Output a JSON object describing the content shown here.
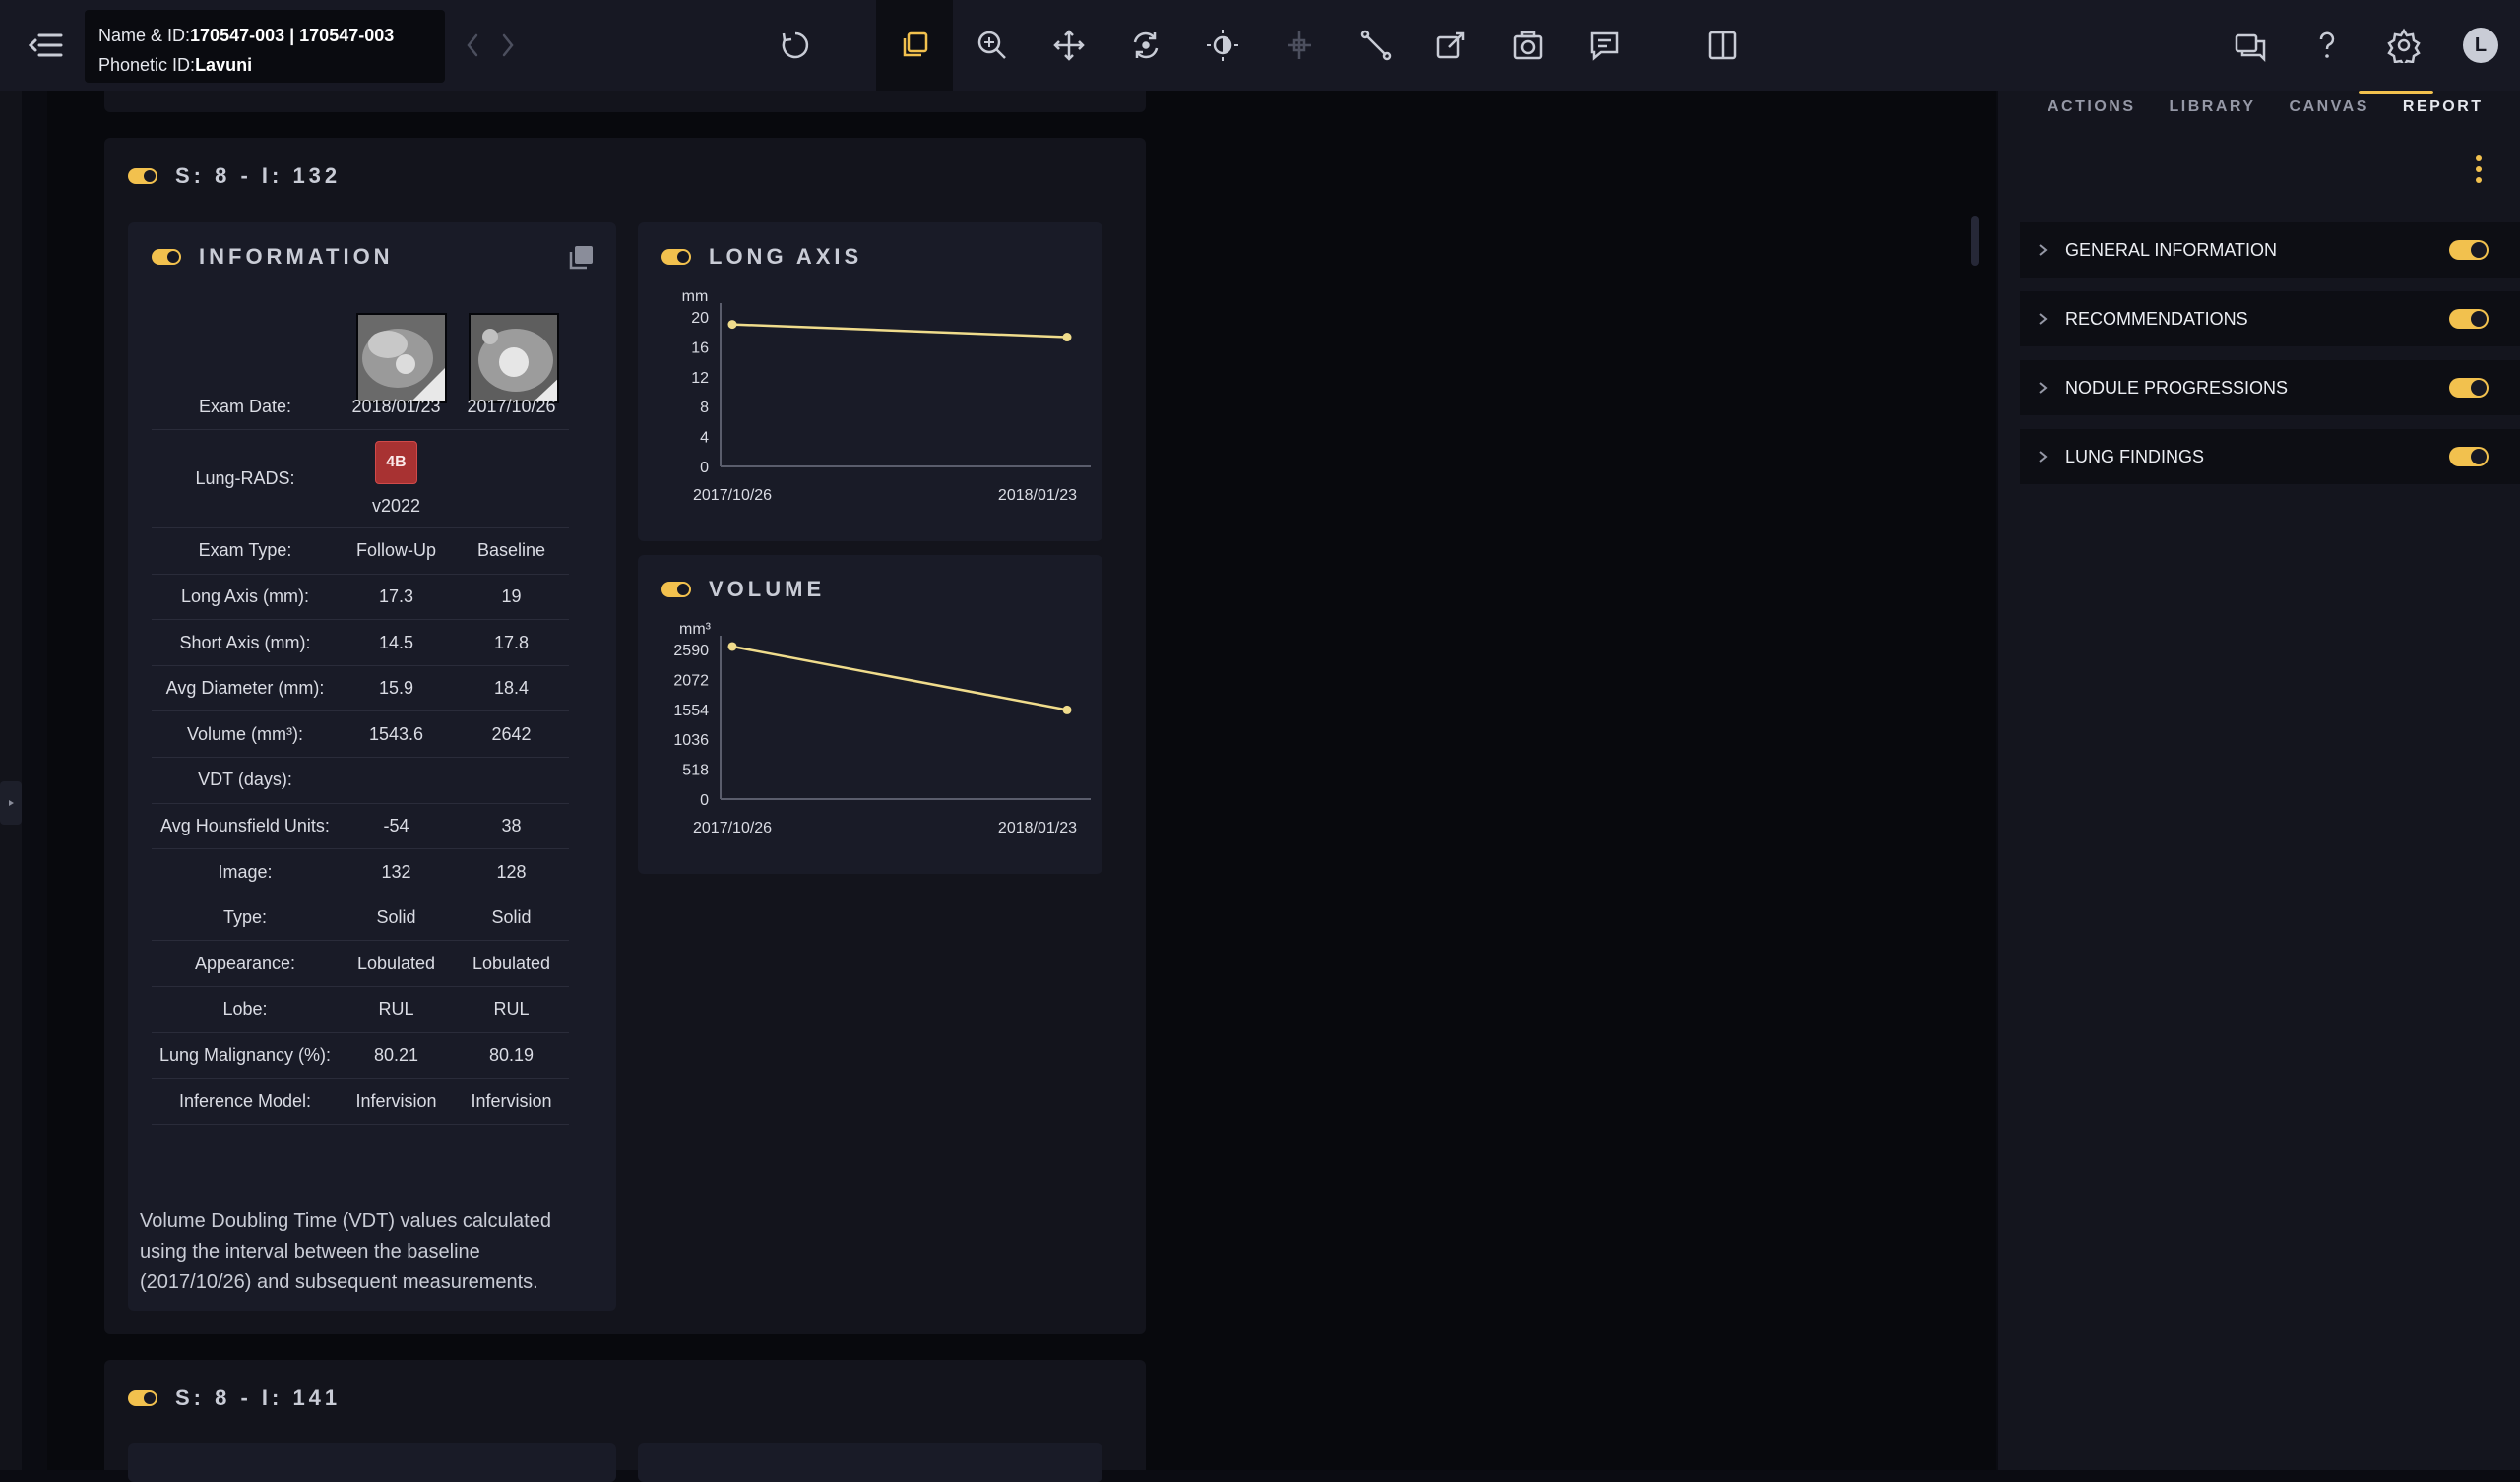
{
  "header": {
    "name_label": "Name & ID:",
    "name_value": "170547-003 | 170547-003",
    "phonetic_label": "Phonetic ID:",
    "phonetic_value": "Lavuni"
  },
  "toolbar": {
    "tools": [
      "reset-icon",
      "stack-icon",
      "zoom-icon",
      "pan-icon",
      "rotate-icon",
      "contrast-icon",
      "crosshair-icon",
      "ruler-icon",
      "annotate-icon",
      "capture-icon",
      "comment-icon",
      "split-view-icon"
    ],
    "right_icons": [
      "chat-icon",
      "help-icon",
      "settings-icon"
    ],
    "avatar_initial": "L",
    "accent": "#f2c14e"
  },
  "sidepanel": {
    "tabs": [
      {
        "label": "ACTIONS"
      },
      {
        "label": "LIBRARY"
      },
      {
        "label": "CANVAS"
      },
      {
        "label": "REPORT",
        "active": true
      }
    ],
    "sections": [
      {
        "label": "GENERAL INFORMATION",
        "enabled": true
      },
      {
        "label": "RECOMMENDATIONS",
        "enabled": true
      },
      {
        "label": "NODULE PROGRESSIONS",
        "enabled": true
      },
      {
        "label": "LUNG FINDINGS",
        "enabled": true
      }
    ]
  },
  "nodule1": {
    "title": "S: 8 - I: 132",
    "info_title": "INFORMATION",
    "columns": [
      "2018/01/23",
      "2017/10/26"
    ],
    "exam_date_label": "Exam Date:",
    "lungrads_label": "Lung-RADS:",
    "lungrads_badge": "4B",
    "lungrads_version": "v2022",
    "rows": [
      {
        "label": "Exam Type:",
        "a": "Follow-Up",
        "b": "Baseline"
      },
      {
        "label": "Long Axis (mm):",
        "a": "17.3",
        "b": "19"
      },
      {
        "label": "Short Axis (mm):",
        "a": "14.5",
        "b": "17.8"
      },
      {
        "label": "Avg Diameter (mm):",
        "a": "15.9",
        "b": "18.4"
      },
      {
        "label": "Volume (mm³):",
        "a": "1543.6",
        "b": "2642"
      },
      {
        "label": "VDT (days):",
        "a": "",
        "b": ""
      },
      {
        "label": "Avg Hounsfield Units:",
        "a": "-54",
        "b": "38"
      },
      {
        "label": "Image:",
        "a": "132",
        "b": "128"
      },
      {
        "label": "Type:",
        "a": "Solid",
        "b": "Solid"
      },
      {
        "label": "Appearance:",
        "a": "Lobulated",
        "b": "Lobulated"
      },
      {
        "label": "Lobe:",
        "a": "RUL",
        "b": "RUL"
      },
      {
        "label": "Lung Malignancy (%):",
        "a": "80.21",
        "b": "80.19"
      },
      {
        "label": "Inference Model:",
        "a": "Infervision",
        "b": "Infervision"
      }
    ],
    "note": "Volume Doubling Time (VDT) values calculated using the interval between the baseline (2017/10/26) and subsequent measurements."
  },
  "nodule2": {
    "title": "S: 8 - I: 141"
  },
  "chart_data": [
    {
      "type": "line",
      "title": "LONG AXIS",
      "ylabel": "mm",
      "categories": [
        "2017/10/26",
        "2018/01/23"
      ],
      "values": [
        19,
        17.3
      ],
      "yticks": [
        "0",
        "4",
        "8",
        "12",
        "16",
        "20"
      ],
      "ylim": [
        0,
        20
      ],
      "color": "#f0dc8c"
    },
    {
      "type": "line",
      "title": "VOLUME",
      "ylabel": "mm³",
      "categories": [
        "2017/10/26",
        "2018/01/23"
      ],
      "values": [
        2642,
        1543.6
      ],
      "yticks": [
        "0",
        "518",
        "1036",
        "1554",
        "2072",
        "2590"
      ],
      "ylim": [
        0,
        2590
      ],
      "color": "#f0dc8c"
    }
  ]
}
